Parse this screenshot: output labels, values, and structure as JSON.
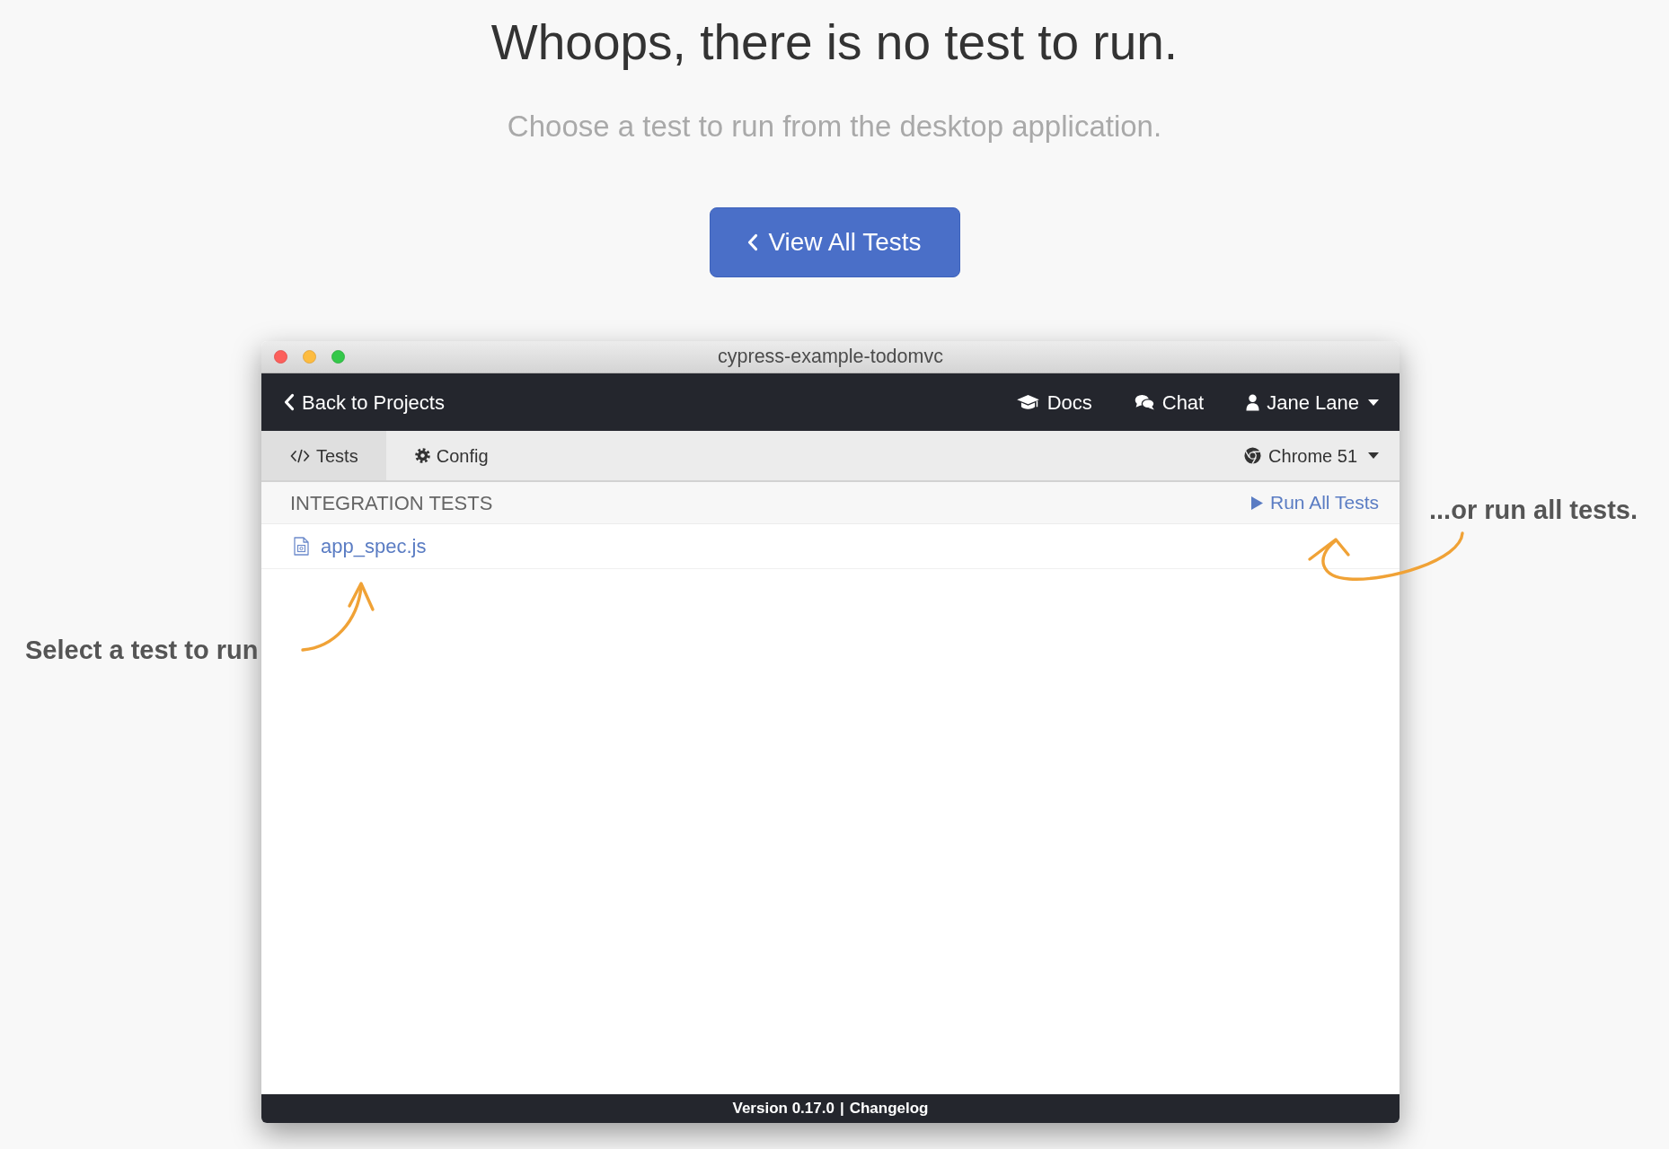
{
  "page": {
    "heading": "Whoops, there is no test to run.",
    "subtitle": "Choose a test to run from the desktop application.",
    "button": {
      "label": "View All Tests"
    }
  },
  "window": {
    "title": "cypress-example-todomvc",
    "navbar": {
      "back_link": "Back to Projects",
      "items": [
        {
          "kind": "docs",
          "label": "Docs",
          "dropdown": false
        },
        {
          "kind": "chat",
          "label": "Chat",
          "dropdown": false
        },
        {
          "kind": "user",
          "label": "Jane Lane",
          "dropdown": true
        }
      ]
    },
    "tabs": [
      {
        "kind": "tests",
        "label": "Tests",
        "selected": true
      },
      {
        "kind": "config",
        "label": "Config",
        "selected": false
      }
    ],
    "browser": {
      "label": "Chrome 51"
    },
    "section": {
      "title": "INTEGRATION TESTS",
      "action": "Run All Tests"
    },
    "files": [
      {
        "name": "app_spec.js"
      }
    ],
    "footer": {
      "version": "Version 0.17.0",
      "separator": "|",
      "link": "Changelog"
    }
  },
  "annotations": [
    {
      "kind": "left",
      "text": "Select a test to run"
    },
    {
      "kind": "right",
      "text": "...or run all tests."
    }
  ]
}
